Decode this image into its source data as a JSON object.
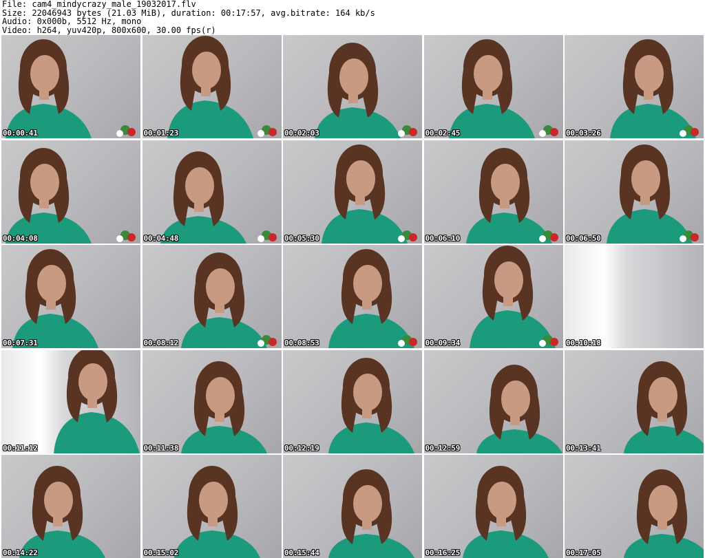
{
  "header": {
    "file": "File: cam4_mindycrazy_male_19032017.flv",
    "size": "Size: 22046943 bytes (21.03 MiB), duration: 00:17:57, avg.bitrate: 164 kb/s",
    "audio": "Audio: 0x000b, 5512 Hz, mono",
    "video": "Video: h264, yuv420p, 800x600, 30.00 fps(r)"
  },
  "thumbnails": [
    {
      "time": "00:00:41"
    },
    {
      "time": "00:01:23"
    },
    {
      "time": "00:02:03"
    },
    {
      "time": "00:02:45"
    },
    {
      "time": "00:03:26"
    },
    {
      "time": "00:04:08"
    },
    {
      "time": "00:04:48"
    },
    {
      "time": "00:05:30"
    },
    {
      "time": "00:06:10"
    },
    {
      "time": "00:06:50"
    },
    {
      "time": "00:07:31"
    },
    {
      "time": "00:08:12"
    },
    {
      "time": "00:08:53"
    },
    {
      "time": "00:09:34"
    },
    {
      "time": "00:10:18"
    },
    {
      "time": "00:11:12"
    },
    {
      "time": "00:11:38"
    },
    {
      "time": "00:12:19"
    },
    {
      "time": "00:12:59"
    },
    {
      "time": "00:13:41"
    },
    {
      "time": "00:14:22"
    },
    {
      "time": "00:15:02"
    },
    {
      "time": "00:15:44"
    },
    {
      "time": "00:16:25"
    },
    {
      "time": "00:17:05"
    }
  ],
  "colors": {
    "sweater": "#1c9a7c",
    "hair": "#5a3422",
    "skin": "#c89a82"
  }
}
